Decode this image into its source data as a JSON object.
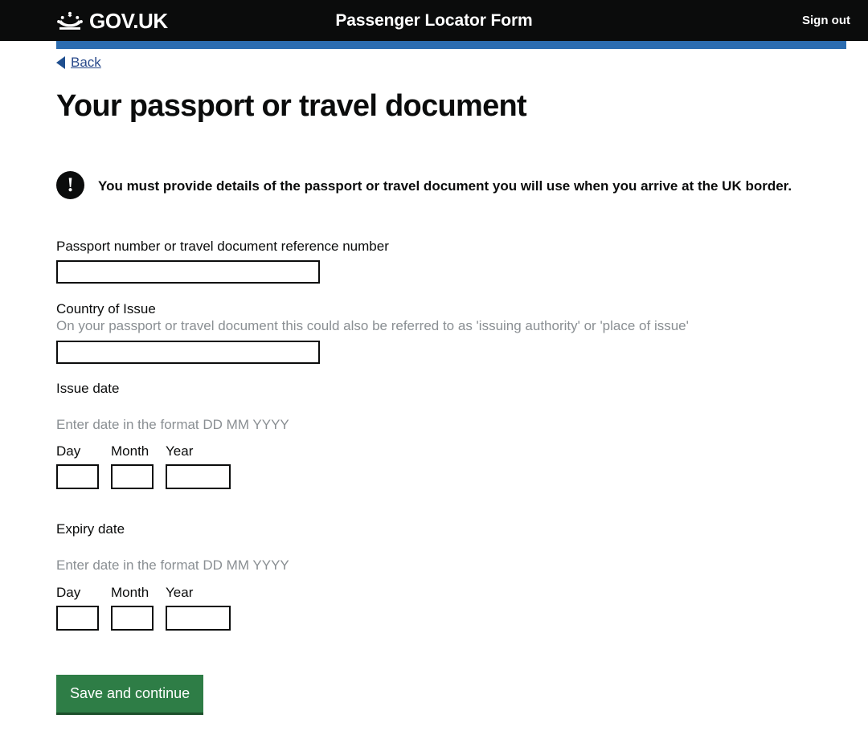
{
  "header": {
    "brand_label": "GOV.UK",
    "crown_icon": "crown-icon",
    "service_name": "Passenger Locator Form",
    "sign_out_label": "Sign out"
  },
  "phase_bar": {
    "color": "#2b6cb0"
  },
  "back_link": {
    "label": "Back",
    "icon": "back-arrow-icon",
    "color": "#2a4a8b"
  },
  "main": {
    "page_title": "Your passport or travel document",
    "warning": {
      "icon": "warning-exclamation-icon",
      "text": "You must provide details of the passport or travel document you will use when you arrive at the UK border."
    },
    "passport_number": {
      "label": "Passport number or travel document reference number",
      "value": "",
      "placeholder": ""
    },
    "country_of_issue": {
      "label": "Country of Issue",
      "hint": "On your passport or travel document this could also be referred to as 'issuing authority' or 'place of issue'",
      "value": "",
      "placeholder": ""
    },
    "issue_date": {
      "label": "Issue date",
      "hint": "Enter date in the format DD MM YYYY",
      "day_label": "Day",
      "month_label": "Month",
      "year_label": "Year",
      "day_value": "",
      "month_value": "",
      "year_value": ""
    },
    "expiry_date": {
      "label": "Expiry date",
      "hint": "Enter date in the format DD MM YYYY",
      "day_label": "Day",
      "month_label": "Month",
      "year_label": "Year",
      "day_value": "",
      "month_value": "",
      "year_value": ""
    },
    "submit": {
      "label": "Save and continue",
      "color": "#2e7d46"
    }
  }
}
